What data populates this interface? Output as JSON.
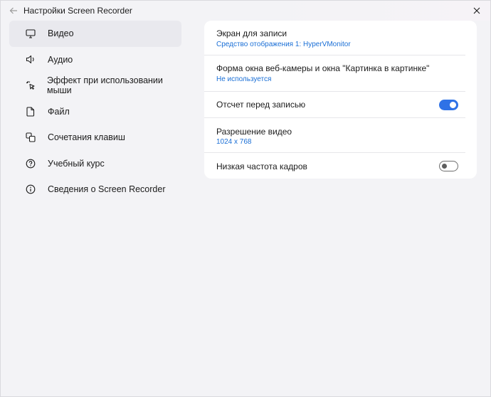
{
  "window": {
    "title": "Настройки Screen Recorder"
  },
  "sidebar": {
    "items": [
      {
        "label": "Видео",
        "icon": "monitor-icon",
        "active": true
      },
      {
        "label": "Аудио",
        "icon": "speaker-icon",
        "active": false
      },
      {
        "label": "Эффект при использовании мыши",
        "icon": "cursor-click-icon",
        "active": false
      },
      {
        "label": "Файл",
        "icon": "file-icon",
        "active": false
      },
      {
        "label": "Сочетания клавиш",
        "icon": "keyboard-shortcut-icon",
        "active": false
      },
      {
        "label": "Учебный курс",
        "icon": "help-icon",
        "active": false
      },
      {
        "label": "Сведения о Screen Recorder",
        "icon": "info-icon",
        "active": false
      }
    ]
  },
  "settings": {
    "screen": {
      "title": "Экран для записи",
      "value": "Средство отображения  1: HyperVMonitor"
    },
    "webcam": {
      "title": "Форма окна веб-камеры и окна \"Картинка в картинке\"",
      "value": "Не используется"
    },
    "countdown": {
      "title": "Отсчет перед записью",
      "enabled": true
    },
    "resolution": {
      "title": "Разрешение видео",
      "value": "1024 x 768"
    },
    "low_fps": {
      "title": "Низкая частота кадров",
      "enabled": false
    }
  },
  "colors": {
    "accent": "#2f72e6",
    "link": "#1a6fd6",
    "background": "#f3f3f6",
    "panel": "#ffffff"
  }
}
